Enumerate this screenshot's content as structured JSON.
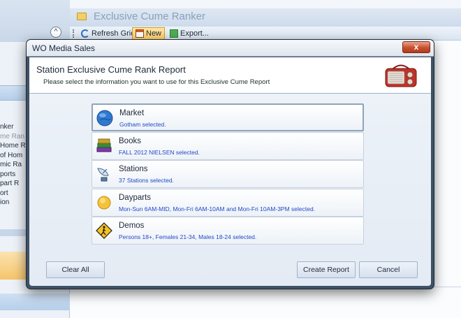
{
  "background": {
    "window_title": "Exclusive Cume Ranker",
    "toolbar": {
      "refresh_label": "Refresh Grid",
      "new_label": "New",
      "export_label": "Export..."
    },
    "sidebar_items": [
      "nker",
      "me Ran",
      "Home R",
      "of Hom",
      "mic Ra",
      "ports",
      "part R",
      "ort",
      "ion"
    ]
  },
  "dialog": {
    "title": "WO Media Sales",
    "close_label": "x",
    "header_title": "Station Exclusive Cume Rank Report",
    "header_subtitle": "Please select the information you want to use for this Exclusive Cume Report",
    "options": [
      {
        "label": "Market",
        "desc": "Gotham selected.",
        "icon": "globe-icon"
      },
      {
        "label": "Books",
        "desc": "FALL 2012 NIELSEN selected.",
        "icon": "books-icon"
      },
      {
        "label": "Stations",
        "desc": "37 Stations selected.",
        "icon": "satellite-dish-icon"
      },
      {
        "label": "Dayparts",
        "desc": "Mon-Sun 6AM-MID,  Mon-Fri 6AM-10AM  and  Mon-Fri 10AM-3PM  selected.",
        "icon": "sun-icon"
      },
      {
        "label": "Demos",
        "desc": "Persons  18+, Females  21-34, Males  18-24 selected.",
        "icon": "pedestrian-sign-icon"
      }
    ],
    "buttons": {
      "clear_all": "Clear All",
      "create_report": "Create Report",
      "cancel": "Cancel"
    }
  }
}
